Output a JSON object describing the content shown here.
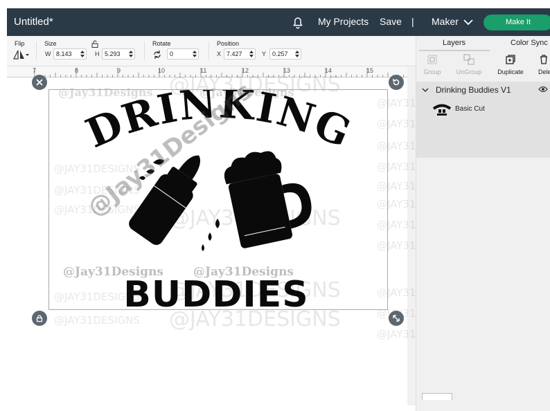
{
  "topbar": {
    "title": "Untitled*",
    "my_projects": "My Projects",
    "save": "Save",
    "separator": "|",
    "machine": "Maker",
    "make_it": "Make It"
  },
  "toolbar": {
    "flip_label": "Flip",
    "size_label": "Size",
    "w_label": "W",
    "w_value": "8.143",
    "h_label": "H",
    "h_value": "5.293",
    "rotate_label": "Rotate",
    "rotate_value": "0",
    "position_label": "Position",
    "x_label": "X",
    "x_value": "7.427",
    "y_label": "Y",
    "y_value": "0.257"
  },
  "ruler": {
    "ticks": [
      "7",
      "8",
      "9",
      "10",
      "11",
      "12",
      "13",
      "14",
      "15"
    ]
  },
  "panel": {
    "tab_layers": "Layers",
    "tab_color_sync": "Color Sync",
    "group": "Group",
    "ungroup": "UnGroup",
    "duplicate": "Duplicate",
    "delete": "Dele",
    "layer_name": "Drinking Buddies V1",
    "cut_type": "Basic Cut"
  },
  "design": {
    "line1": "DRINKING",
    "line2": "BUDDIES"
  },
  "watermarks": {
    "handle": "@Jay31Designs",
    "caps": "@JAY31DESIGNS",
    "diagonal": "@Jay31Designs"
  },
  "colors": {
    "topbar": "#2a3a47",
    "make_it": "#1a9e6a",
    "ink": "#0a0a0a"
  }
}
